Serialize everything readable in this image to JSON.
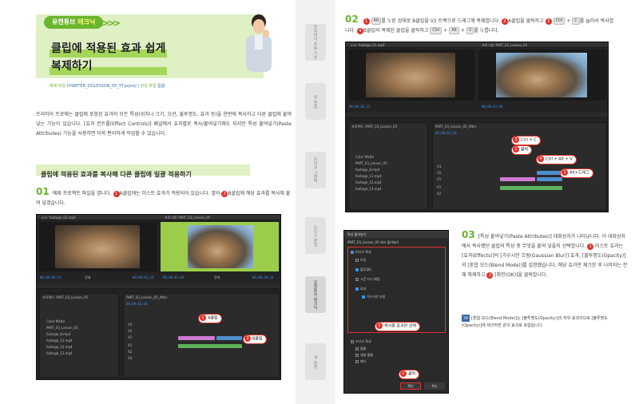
{
  "header": {
    "badge_prefix": "유캔튜브",
    "badge_emphasis": "테크닉",
    "chevrons": ">>>>",
    "title_line1": "클립에 적용된 효과 쉽게",
    "title_line2": "복제하기",
    "meta_prefix": "예제 파일",
    "meta_path": "CHAPTER_03\\LESSON_05_YT.prproj",
    "meta_sep": "|",
    "meta_done": "완성 파일",
    "meta_done_value": "없음"
  },
  "intro": "프리미어 프로에는 클립에 포함된 효과의 모든 특성(위치나 크기, 모션, 불투명도, 효과 등)을 한번에 복사하고 다른 클립에 붙여 넣는 기능이 있습니다. [효과 컨트롤(Effect Controls)] 패널에서 효과별로 복사/붙여넣기해도 되지만 특성 붙여넣기(Paste Attributes) 기능을 사용하면 더욱 편리하게 작업할 수 있습니다.",
  "section_title": "클립에 적용된 효과를 복사해 다른 클립에 일괄 적용하기",
  "step01": {
    "num": "01",
    "text_a": "예제 프로젝트 파일을 엽니다.",
    "n1": "1",
    "text_b": "A클립에는 미스트 효과가 적용되어 있습니다. 옆의",
    "n2": "2",
    "text_c": "B클립에 해당 효과를 복사해 붙여 넣겠습니다."
  },
  "step02": {
    "num": "02",
    "n1": "1",
    "key_alt": "Alt",
    "text_a": "를 누른 상태로 B클립을 V2 트랙으로 드래그해 복제합니다.",
    "n2": "2",
    "text_b": "A클립을 클릭하고",
    "n3": "3",
    "key_ctrl": "Ctrl",
    "plus": "+",
    "key_c": "C",
    "text_c": "를 눌러서 복사합니다.",
    "n4": "4",
    "text_d": "B클립의 복제된 클립을 클릭하고",
    "key_ctrl2": "Ctrl",
    "plus2": "+",
    "key_alt2": "Alt",
    "plus3": "+",
    "key_v": "V",
    "text_e": "를 누릅니다."
  },
  "step03": {
    "num": "03",
    "text": "[특성 붙여넣기(Paste Attributes)] 대화상자가 나타납니다. 이 대화상자에서 복사했던 클립의 특성 중 무엇을 붙여 넣을지 선택합니다.",
    "n1": "1",
    "text_b": "미스트 효과는 [효과(Effects)]의 [가우시안 흐림(Gaussian Blur)] 효과, [불투명도(Opacity)]의 [혼합 모드(Blend Mode)]를 설정했습니다. 해당 효과만 체크한 후 나머지는 전체 해제하고",
    "n2": "2",
    "text_c": "[확인(OK)]을 클릭합니다."
  },
  "tip": {
    "badge": "TIP",
    "text": "[혼합 모드(Blend Mode)]는 [불투명도(Opacity)]의 하위 효과이므로 [불투명도(Opacity)]에 체크하면 같이 효과로 포함됩니다."
  },
  "callouts": {
    "a_clip": "A클립",
    "b_clip": "B클립",
    "ctrl_c": "Ctrl + C",
    "click": "클릭",
    "ctrl_alt_v": "Ctrl + Alt + V",
    "alt_drag": "Alt+드래그",
    "copy_effect": "복사할 효과만 선택",
    "ok_click": "클릭"
  },
  "call_nums": {
    "c1": "1",
    "c2": "2",
    "c3": "3",
    "c4": "4"
  },
  "ui": {
    "tab_source": "소스: footage_01.mp4",
    "tab_program": "프로그램: PART_03_Lesson_05",
    "tc1": "00;00;03;21",
    "tc2": "00;00;01;04",
    "tc3": "00;00;26;24",
    "tc4": "00;00;01;18",
    "project": "프로젝트: PART_03_Lesson_05",
    "seq": "PART_03_Lesson_05_After",
    "items": [
      "Color Matte",
      "PART_03_Lesson_05",
      "footage_8.mp4",
      "footage_11.mp4",
      "footage_12.mp4",
      "footage_13.mp4"
    ],
    "tracks": [
      "V3",
      "V2",
      "V1",
      "A1",
      "A2",
      "A3"
    ],
    "fit": "전체",
    "full": "전체"
  },
  "dialog": {
    "title": "특성 붙여넣기",
    "from": "PART_03_Lesson_05 에서 붙여넣기",
    "group": "비디오 특성",
    "opts": [
      "모션",
      "불투명도",
      "시간 다시 매핑",
      "효과",
      "가우시안 흐림"
    ],
    "audio_group": "오디오 특성",
    "audio_opts": [
      "볼륨",
      "채널 볼륨",
      "패너"
    ],
    "ok": "확인",
    "cancel": "취소"
  },
  "sidebar": {
    "tab1": "프리미어 프로 기초",
    "tab2": "컷 편집",
    "tab3": "자막과 그래픽",
    "tab4": "오디오 편집",
    "tab5": "유캔튜브 테크닉",
    "tab6": "색 보정"
  }
}
